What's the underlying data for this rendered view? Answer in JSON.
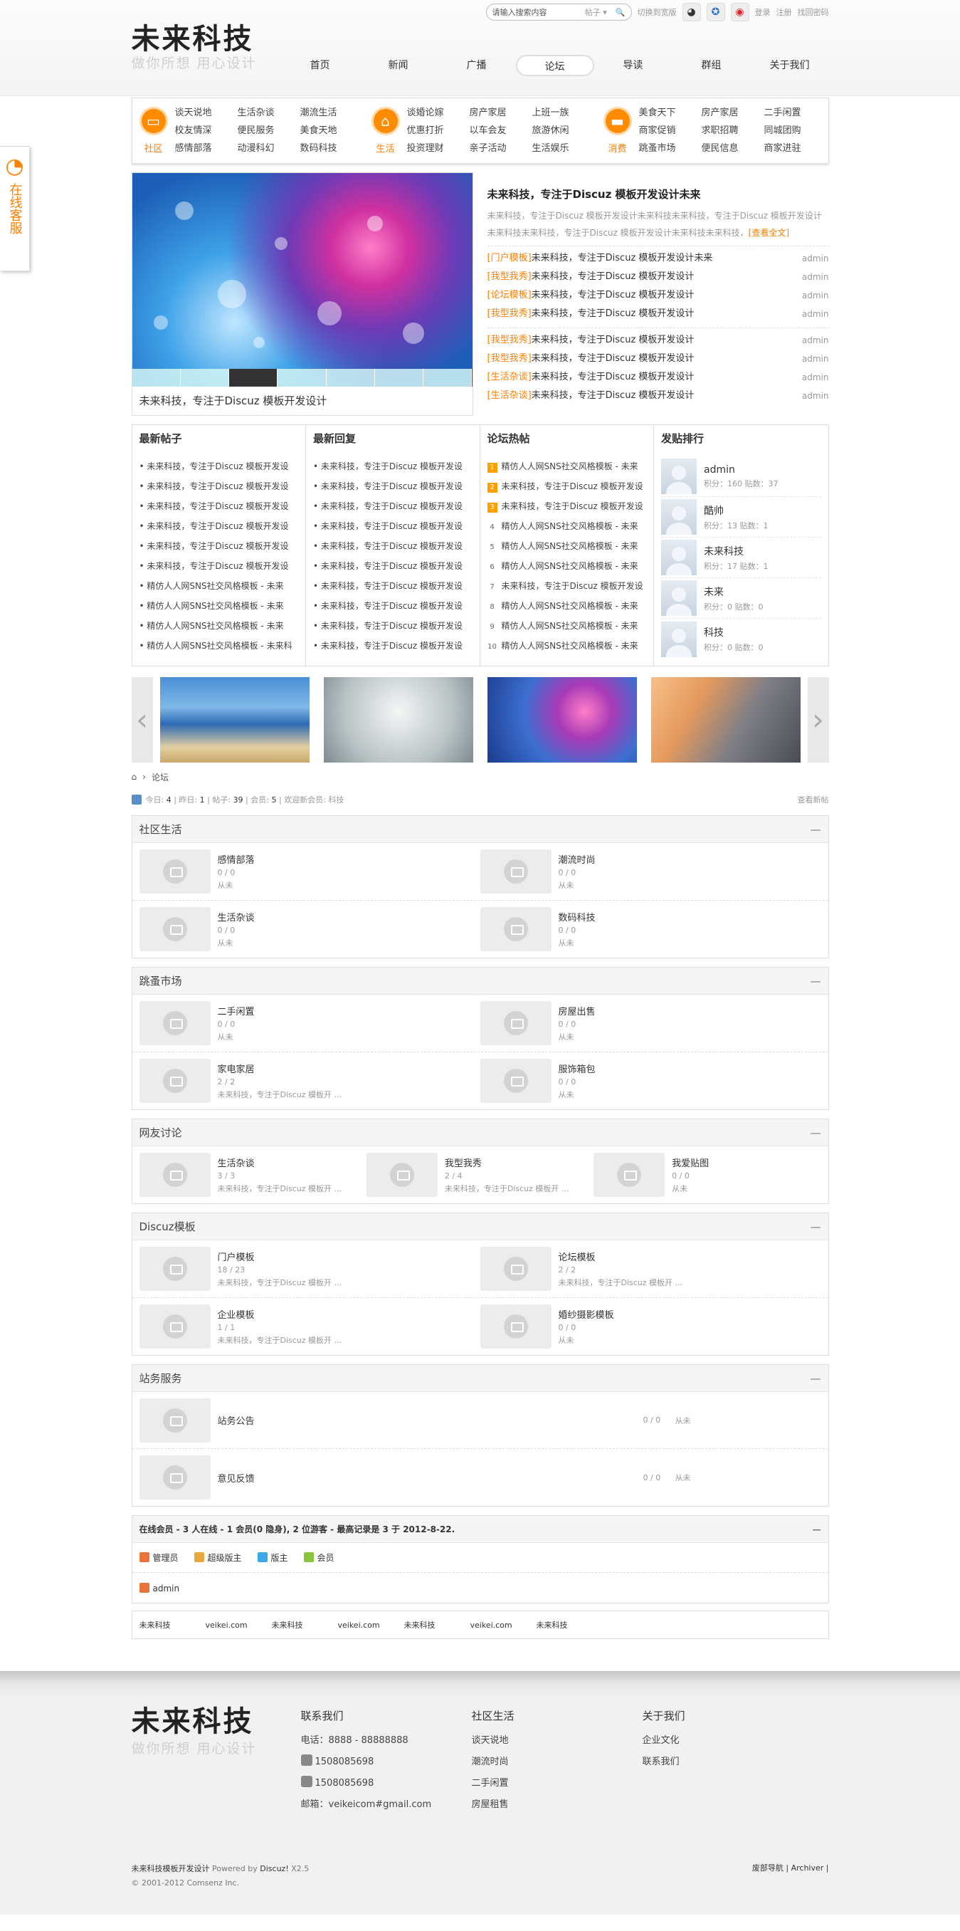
{
  "topbar": {
    "search_placeholder": "请输入搜索内容",
    "search_scope": "帖子",
    "switch_label": "切换到宽版",
    "login": "登录",
    "register": "注册",
    "forgot": "找回密码"
  },
  "logo": {
    "title": "未来科技",
    "slogan": "做你所想 用心设计"
  },
  "nav": [
    "首页",
    "新闻",
    "广播",
    "论坛",
    "导读",
    "群组",
    "关于我们"
  ],
  "nav_active": "论坛",
  "categories": [
    {
      "label": "社区",
      "icon": "chat-icon",
      "links": [
        "谈天说地",
        "生活杂谈",
        "潮流生活",
        "校友情深",
        "便民服务",
        "美食天地",
        "感情部落",
        "动漫科幻",
        "数码科技"
      ]
    },
    {
      "label": "生活",
      "icon": "home-icon",
      "links": [
        "谈婚论嫁",
        "房产家居",
        "上班一族",
        "优惠打折",
        "以车会友",
        "旅游休闲",
        "投资理财",
        "亲子活动",
        "生活娱乐"
      ]
    },
    {
      "label": "消费",
      "icon": "cart-icon",
      "links": [
        "美食天下",
        "房产家居",
        "二手闲置",
        "商家促销",
        "求职招聘",
        "同城团购",
        "跳蚤市场",
        "便民信息",
        "商家进驻"
      ]
    }
  ],
  "slider": {
    "caption": "未来科技，专注于Discuz 模板开发设计"
  },
  "news": {
    "headline": "未来科技，专注于Discuz 模板开发设计未来",
    "summary": "未来科技，专注于Discuz 模板开发设计未来科技未来科技，专注于Discuz 模板开发设计未来科技未来科技，专注于Discuz 模板开发设计未来科技未来科技，",
    "more": "[查看全文]",
    "list1": [
      {
        "tag": "[门户模板]",
        "title": "未来科技，专注于Discuz 模板开发设计未来",
        "author": "admin"
      },
      {
        "tag": "[我型我秀]",
        "title": "未来科技，专注于Discuz 模板开发设计",
        "author": "admin"
      },
      {
        "tag": "[论坛模板]",
        "title": "未来科技，专注于Discuz 模板开发设计",
        "author": "admin"
      },
      {
        "tag": "[我型我秀]",
        "title": "未来科技，专注于Discuz 模板开发设计",
        "author": "admin"
      }
    ],
    "list2": [
      {
        "tag": "[我型我秀]",
        "title": "未来科技，专注于Discuz 模板开发设计",
        "author": "admin"
      },
      {
        "tag": "[我型我秀]",
        "title": "未来科技，专注于Discuz 模板开发设计",
        "author": "admin"
      },
      {
        "tag": "[生活杂谈]",
        "title": "未来科技，专注于Discuz 模板开发设计",
        "author": "admin"
      },
      {
        "tag": "[生活杂谈]",
        "title": "未来科技，专注于Discuz 模板开发设计",
        "author": "admin"
      }
    ]
  },
  "latest_posts": {
    "title": "最新帖子",
    "items": [
      "未来科技，专注于Discuz 模板开发设",
      "未来科技，专注于Discuz 模板开发设",
      "未来科技，专注于Discuz 模板开发设",
      "未来科技，专注于Discuz 模板开发设",
      "未来科技，专注于Discuz 模板开发设",
      "未来科技，专注于Discuz 模板开发设",
      "精仿人人网SNS社交风格模板 - 未来",
      "精仿人人网SNS社交风格模板 - 未来",
      "精仿人人网SNS社交风格模板 - 未来",
      "精仿人人网SNS社交风格模板 - 未来科"
    ]
  },
  "latest_replies": {
    "title": "最新回复",
    "items": [
      "未来科技，专注于Discuz 模板开发设",
      "未来科技，专注于Discuz 模板开发设",
      "未来科技，专注于Discuz 模板开发设",
      "未来科技，专注于Discuz 模板开发设",
      "未来科技，专注于Discuz 模板开发设",
      "未来科技，专注于Discuz 模板开发设",
      "未来科技，专注于Discuz 模板开发设",
      "未来科技，专注于Discuz 模板开发设",
      "未来科技，专注于Discuz 模板开发设",
      "未来科技，专注于Discuz 模板开发设"
    ]
  },
  "hot_posts": {
    "title": "论坛热帖",
    "items": [
      {
        "n": "1",
        "t": "精仿人人网SNS社交风格模板 - 未来"
      },
      {
        "n": "2",
        "t": "未来科技，专注于Discuz 模板开发设"
      },
      {
        "n": "3",
        "t": "未来科技，专注于Discuz 模板开发设"
      },
      {
        "n": "4",
        "t": "精仿人人网SNS社交风格模板 - 未来"
      },
      {
        "n": "5",
        "t": "精仿人人网SNS社交风格模板 - 未来"
      },
      {
        "n": "6",
        "t": "精仿人人网SNS社交风格模板 - 未来"
      },
      {
        "n": "7",
        "t": "未来科技，专注于Discuz 模板开发设"
      },
      {
        "n": "8",
        "t": "精仿人人网SNS社交风格模板 - 未来"
      },
      {
        "n": "9",
        "t": "精仿人人网SNS社交风格模板 - 未来"
      },
      {
        "n": "10",
        "t": "精仿人人网SNS社交风格模板 - 未来"
      }
    ]
  },
  "ranking": {
    "title": "发贴排行",
    "users": [
      {
        "name": "admin",
        "stats": "积分：160 贴数：37"
      },
      {
        "name": "酷帅",
        "stats": "积分：13 贴数：1"
      },
      {
        "name": "未来科技",
        "stats": "积分：17 贴数：1"
      },
      {
        "name": "未来",
        "stats": "积分：0 贴数：0"
      },
      {
        "name": "科技",
        "stats": "积分：0 贴数：0"
      }
    ]
  },
  "breadcrumb": {
    "current": "论坛"
  },
  "stats": {
    "today_label": "今日:",
    "today": "4",
    "yesterday_label": "昨日:",
    "yesterday": "1",
    "posts_label": "帖子:",
    "posts": "39",
    "members_label": "会员:",
    "members": "5",
    "welcome_label": "欢迎新会员:",
    "welcome": "科技",
    "new_posts": "查看新帖"
  },
  "forums": {
    "community": {
      "title": "社区生活",
      "items": [
        {
          "name": "感情部落",
          "count": "0 / 0",
          "last": "从未"
        },
        {
          "name": "潮流时尚",
          "count": "0 / 0",
          "last": "从未"
        },
        {
          "name": "生活杂谈",
          "count": "0 / 0",
          "last": "从未"
        },
        {
          "name": "数码科技",
          "count": "0 / 0",
          "last": "从未"
        }
      ]
    },
    "market": {
      "title": "跳蚤市场",
      "items": [
        {
          "name": "二手闲置",
          "count": "0 / 0",
          "last": "从未"
        },
        {
          "name": "房屋出售",
          "count": "0 / 0",
          "last": "从未"
        },
        {
          "name": "家电家居",
          "count": "2 / 2",
          "last": "未来科技，专注于Discuz 模板开 ..."
        },
        {
          "name": "服饰箱包",
          "count": "0 / 0",
          "last": "从未"
        }
      ]
    },
    "discuss": {
      "title": "网友讨论",
      "items": [
        {
          "name": "生活杂谈",
          "count": "3 / 3",
          "last": "未来科技，专注于Discuz 模板开 ..."
        },
        {
          "name": "我型我秀",
          "count": "2 / 4",
          "last": "未来科技，专注于Discuz 模板开 ..."
        },
        {
          "name": "我爱贴图",
          "count": "0 / 0",
          "last": "从未"
        }
      ]
    },
    "discuz": {
      "title": "Discuz模板",
      "items": [
        {
          "name": "门户模板",
          "count": "18 / 23",
          "last": "未来科技，专注于Discuz 模板开 ..."
        },
        {
          "name": "论坛模板",
          "count": "2 / 2",
          "last": "未来科技，专注于Discuz 模板开 ..."
        },
        {
          "name": "企业模板",
          "count": "1 / 1",
          "last": "未来科技，专注于Discuz 模板开 ..."
        },
        {
          "name": "婚纱摄影模板",
          "count": "0 / 0",
          "last": "从未"
        }
      ]
    },
    "service": {
      "title": "站务服务",
      "items": [
        {
          "name": "站务公告",
          "count": "0 / 0",
          "last": "从未"
        },
        {
          "name": "意见反馈",
          "count": "0 / 0",
          "last": "从未"
        }
      ]
    }
  },
  "online": {
    "summary": "在线会员 - 3 人在线 - 1 会员(0 隐身), 2 位游客 - 最高记录是 3 于 2012-8-22.",
    "legend": [
      {
        "label": "管理员",
        "color": "#e8743b"
      },
      {
        "label": "超级版主",
        "color": "#e8a83b"
      },
      {
        "label": "版主",
        "color": "#3ba8e8"
      },
      {
        "label": "会员",
        "color": "#8ac43b"
      }
    ],
    "user": "admin"
  },
  "links": [
    "未来科技",
    "veikei.com",
    "未来科技",
    "veikei.com",
    "未来科技",
    "veikei.com",
    "未来科技"
  ],
  "footer": {
    "contact": {
      "title": "联系我们",
      "phone": "电话：8888 - 88888888",
      "qq1": "1508085698",
      "qq2": "1508085698",
      "email": "邮箱：veikeicom#gmail.com"
    },
    "community": {
      "title": "社区生活",
      "items": [
        "谈天说地",
        "潮流时尚",
        "二手闲置",
        "房屋租售"
      ]
    },
    "about": {
      "title": "关于我们",
      "items": [
        "企业文化",
        "联系我们"
      ]
    },
    "copyright_name": "未来科技模板开发设计",
    "powered_by": "Powered by",
    "discuz": "Discuz!",
    "version": "X2.5",
    "copyright": "© 2001-2012 Comsenz Inc.",
    "footer_links": "废部导航 | Archiver |"
  },
  "side_service": {
    "label": "在线客服"
  },
  "colors": {
    "accent": "#ff7f00",
    "border": "#dddddd"
  }
}
